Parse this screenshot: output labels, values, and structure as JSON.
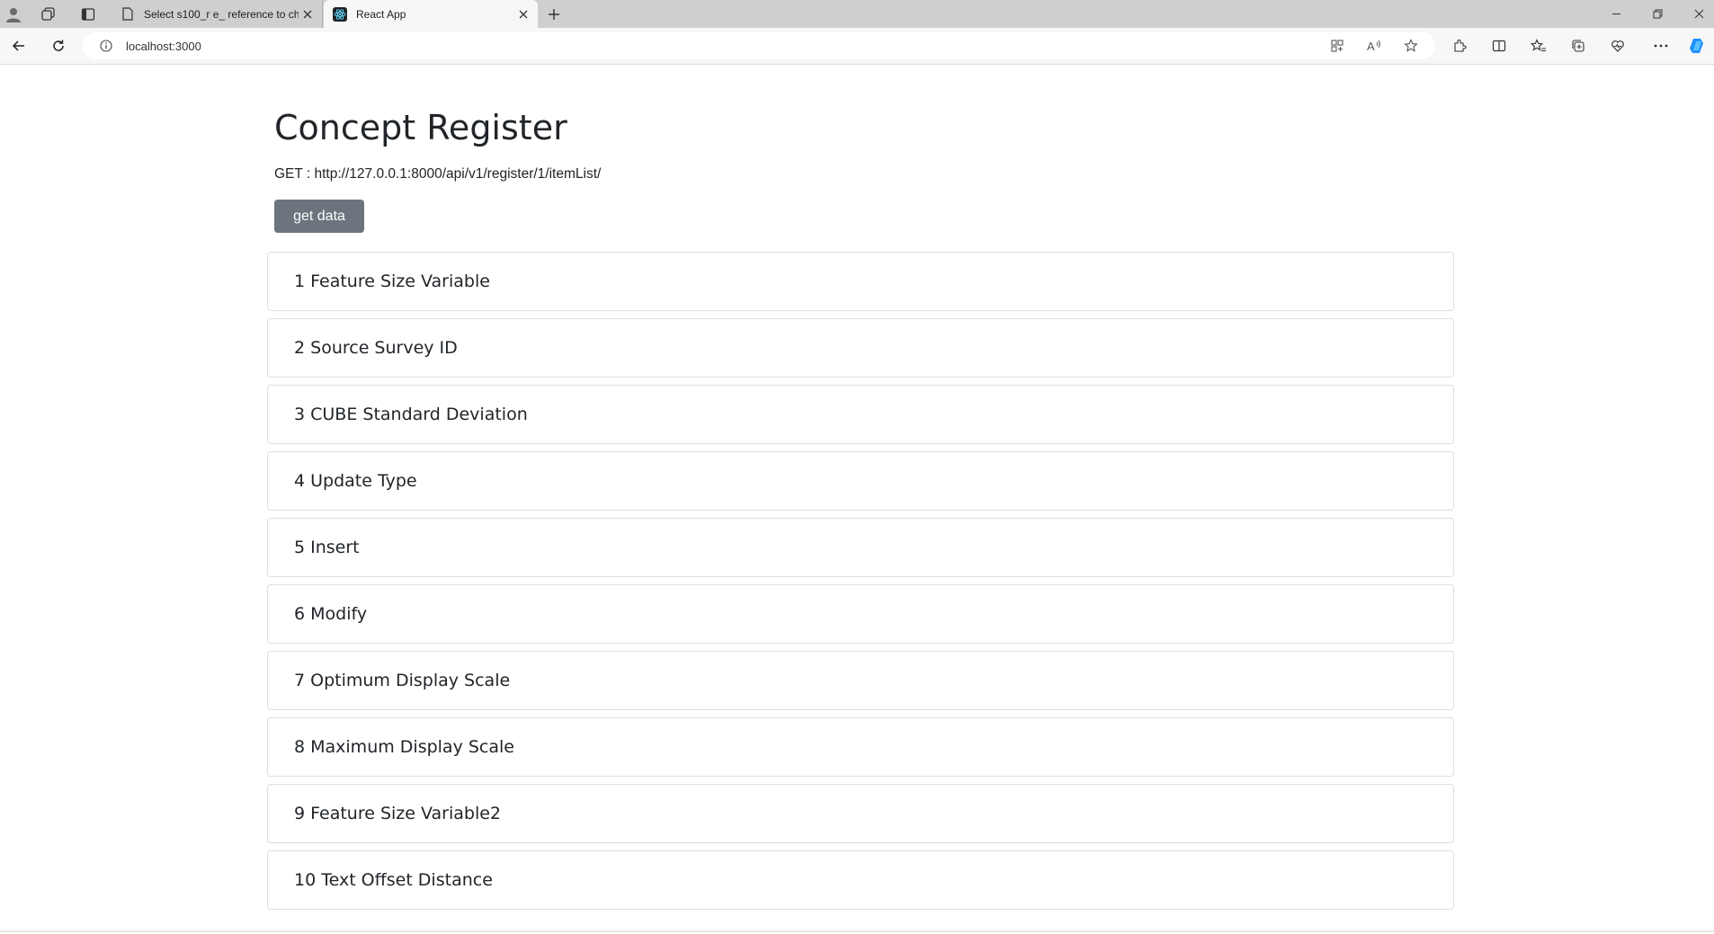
{
  "browser": {
    "tabs": [
      {
        "title": "Select s100_r e_ reference to cha",
        "active": false,
        "icon": "document-icon"
      },
      {
        "title": "React App",
        "active": true,
        "icon": "react-icon"
      }
    ],
    "address": "localhost:3000"
  },
  "page": {
    "title": "Concept Register",
    "endpoint": "GET : http://127.0.0.1:8000/api/v1/register/1/itemList/",
    "button_label": "get data",
    "items": [
      {
        "label": "1 Feature Size Variable"
      },
      {
        "label": "2 Source Survey ID"
      },
      {
        "label": "3 CUBE Standard Deviation"
      },
      {
        "label": "4 Update Type"
      },
      {
        "label": "5 Insert"
      },
      {
        "label": "6 Modify"
      },
      {
        "label": "7 Optimum Display Scale"
      },
      {
        "label": "8 Maximum Display Scale"
      },
      {
        "label": "9 Feature Size Variable2"
      },
      {
        "label": "10 Text Offset Distance"
      }
    ]
  },
  "colors": {
    "button_bg": "#6c757d",
    "tabbar_bg": "#cfcfcf",
    "copilot": "#1e90ff"
  }
}
